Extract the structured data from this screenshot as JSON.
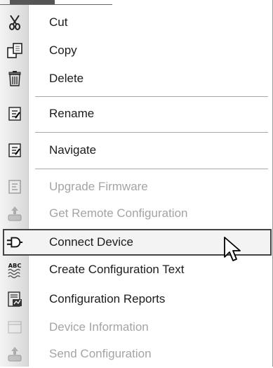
{
  "menu": {
    "items": [
      {
        "label": "Cut",
        "icon": "scissors-icon",
        "enabled": true
      },
      {
        "label": "Copy",
        "icon": "copy-icon",
        "enabled": true
      },
      {
        "label": "Delete",
        "icon": "trash-icon",
        "enabled": true
      },
      {
        "label": "Rename",
        "icon": "rename-icon",
        "enabled": true
      },
      {
        "label": "Navigate",
        "icon": "navigate-icon",
        "enabled": true
      },
      {
        "label": "Upgrade Firmware",
        "icon": "firmware-icon",
        "enabled": false
      },
      {
        "label": "Get Remote Configuration",
        "icon": "remote-config-icon",
        "enabled": false
      },
      {
        "label": "Connect Device",
        "icon": "plug-icon",
        "enabled": true,
        "highlighted": true
      },
      {
        "label": "Create Configuration Text",
        "icon": "abc-text-icon",
        "enabled": true
      },
      {
        "label": "Configuration Reports",
        "icon": "report-icon",
        "enabled": true
      },
      {
        "label": "Device Information",
        "icon": "device-info-icon",
        "enabled": false
      },
      {
        "label": "Send Configuration",
        "icon": "send-config-icon",
        "enabled": false
      }
    ]
  },
  "colors": {
    "text": "#1c1c1c",
    "disabled_text": "#a4a4a4",
    "highlight_border": "#444444"
  }
}
